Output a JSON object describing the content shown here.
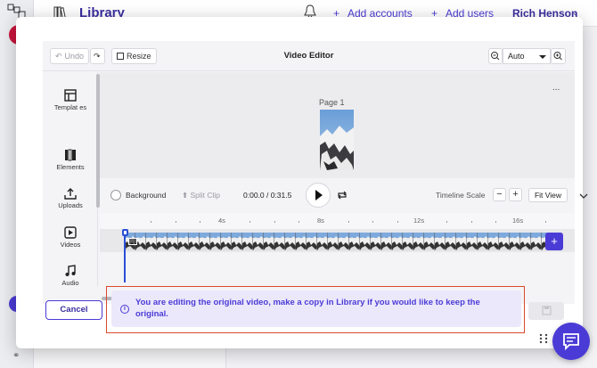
{
  "app": {
    "title": "Library",
    "add_accounts": "Add accounts",
    "add_users": "Add users",
    "user_name": "Rich Henson",
    "plus": "+"
  },
  "editor": {
    "title": "Video Editor",
    "undo_label": "Undo",
    "resize_label": "Resize",
    "zoom_value": "Auto",
    "page_label": "Page 1",
    "more_menu": "...",
    "tools": [
      {
        "label": "Templat es",
        "icon": "templates-icon"
      },
      {
        "label": "Elements",
        "icon": "elements-icon"
      },
      {
        "label": "Uploads",
        "icon": "uploads-icon"
      },
      {
        "label": "Videos",
        "icon": "videos-icon"
      },
      {
        "label": "Audio",
        "icon": "audio-icon"
      }
    ]
  },
  "controls": {
    "background_label": "Background",
    "split_clip_label": "Split Clip",
    "time_readout": "0:00.0 / 0:31.5",
    "timeline_scale_label": "Timeline Scale",
    "minus": "−",
    "plus": "+",
    "fit_view_label": "Fit View"
  },
  "timeline": {
    "ticks": [
      "4s",
      "8s",
      "12s",
      "16s"
    ],
    "add_clip": "+"
  },
  "footer": {
    "cancel_label": "Cancel",
    "info_message": "You are editing the original video, make a copy in Library if you would like to keep the original."
  },
  "colors": {
    "accent": "#4b3bd6",
    "highlight_border": "#d94a2b",
    "info_background": "#ebe8fb"
  }
}
